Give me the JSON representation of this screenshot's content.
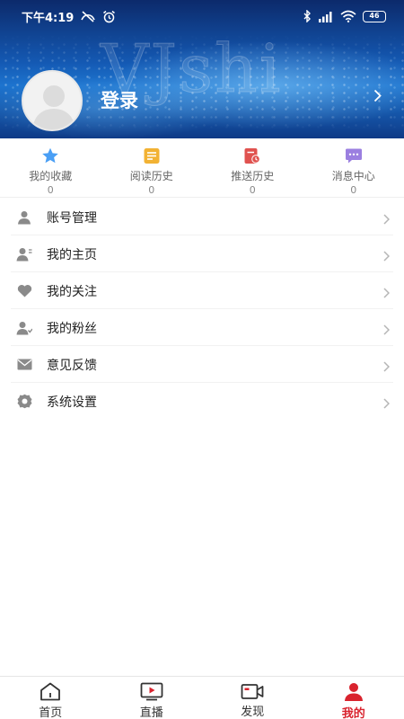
{
  "status_bar": {
    "time": "下午4:19",
    "battery": "46"
  },
  "header": {
    "watermark": "VJshi",
    "login_label": "登录"
  },
  "shortcuts": [
    {
      "label": "我的收藏",
      "count": "0",
      "icon": "star-icon",
      "color": "#4a9ff5"
    },
    {
      "label": "阅读历史",
      "count": "0",
      "icon": "document-icon",
      "color": "#f2b233"
    },
    {
      "label": "推送历史",
      "count": "0",
      "icon": "push-history-icon",
      "color": "#e0524f"
    },
    {
      "label": "消息中心",
      "count": "0",
      "icon": "message-icon",
      "color": "#9b7fe0"
    }
  ],
  "menu": [
    {
      "label": "账号管理",
      "icon": "account-icon"
    },
    {
      "label": "我的主页",
      "icon": "homepage-user-icon"
    },
    {
      "label": "我的关注",
      "icon": "heart-icon"
    },
    {
      "label": "我的粉丝",
      "icon": "fans-icon"
    },
    {
      "label": "意见反馈",
      "icon": "mail-icon"
    },
    {
      "label": "系统设置",
      "icon": "settings-gear-icon"
    }
  ],
  "bottom_nav": [
    {
      "label": "首页",
      "icon": "home-icon",
      "active": false
    },
    {
      "label": "直播",
      "icon": "live-tv-icon",
      "active": false
    },
    {
      "label": "发现",
      "icon": "video-camera-icon",
      "active": false
    },
    {
      "label": "我的",
      "icon": "profile-icon",
      "active": true
    }
  ],
  "colors": {
    "active_tab": "#d9232e",
    "icon_gray": "#8a8a8a"
  }
}
